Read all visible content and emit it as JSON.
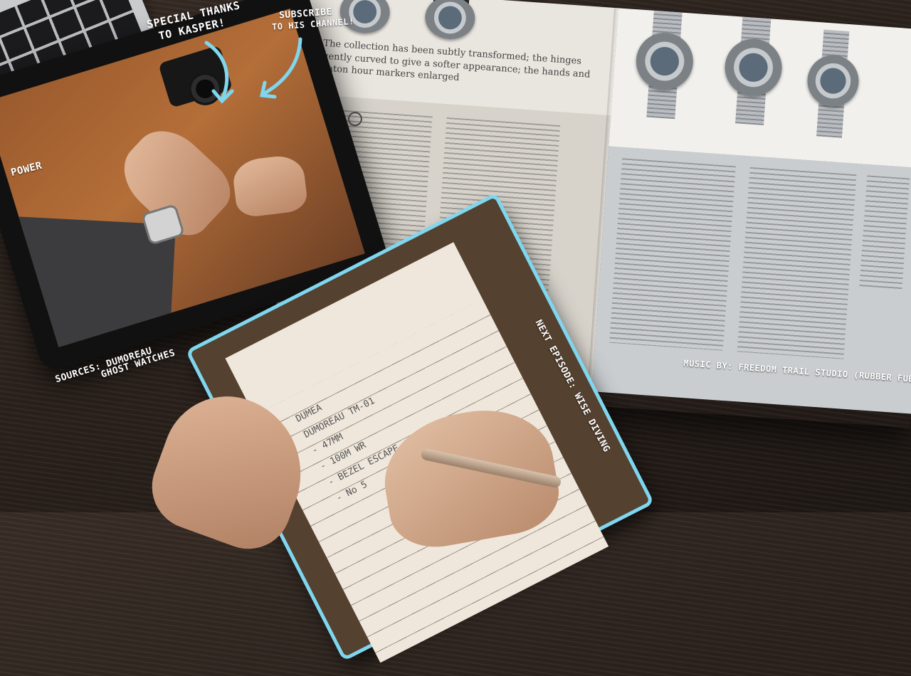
{
  "overlay_labels": {
    "special_thanks": "SPECIAL THANKS",
    "special_thanks_2": "TO KASPER!",
    "subscribe": "SUBSCRIBE",
    "subscribe_2": "TO HIS CHANNEL!",
    "power": "POWER",
    "sources": "SOURCES: DUMOREAU",
    "sources_2": "GHOST WATCHES",
    "next_episode": "NEXT EPISODE: WISE DIVING",
    "music": "MUSIC BY: FREEDOM TRAIL STUDIO (RUBBER FUBS)"
  },
  "magazine": {
    "caption": "The collection has been subtly transformed; the hinges gently curved to give a softer appearance; the hands and baton hour markers enlarged"
  },
  "notepad": {
    "lines": [
      "DUMEA",
      "DUMOREAU  TM-01",
      "- 47MM",
      "- 100M WR",
      "- BEZEL ESCAPE",
      "- No 5"
    ]
  },
  "colors": {
    "accent_outline": "#7fd6ef",
    "table": "#2b221d"
  }
}
